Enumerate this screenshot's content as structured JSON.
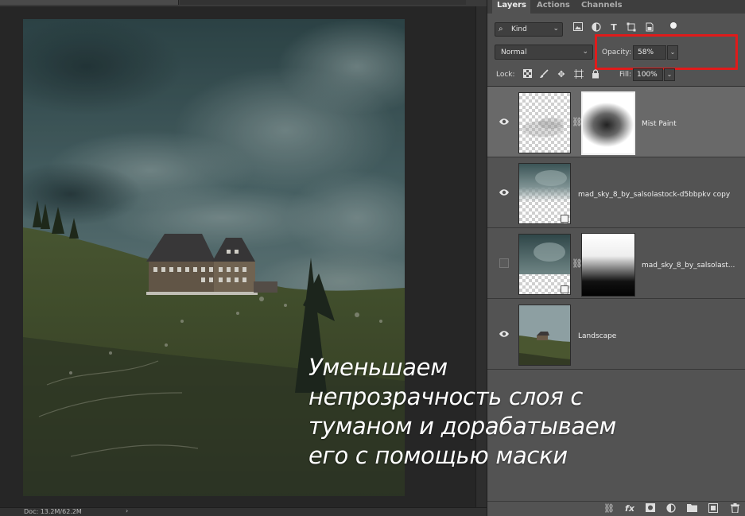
{
  "status": {
    "doc": "Doc: 13.2M/62.2M",
    "arrow": "›"
  },
  "caption": {
    "lines": [
      "Уменьшаем",
      "непрозрачность слоя с",
      "туманом и дорабатываем",
      "его с помощью маски"
    ]
  },
  "panel": {
    "tabs": [
      "Layers",
      "Actions",
      "Channels"
    ],
    "kind_label": "Kind",
    "blend_mode": "Normal",
    "opacity_label": "Opacity:",
    "opacity_value": "58%",
    "lock_label": "Lock:",
    "fill_label": "Fill:",
    "fill_value": "100%",
    "highlight_color": "#e01b1b"
  },
  "layers": [
    {
      "name": "Mist Paint",
      "visible": true,
      "selected": true
    },
    {
      "name": "mad_sky_8_by_salsolastock-d5bbpkv copy",
      "visible": true,
      "selected": false
    },
    {
      "name": "mad_sky_8_by_salsolast...",
      "visible": false,
      "selected": false
    },
    {
      "name": "Landscape",
      "visible": true,
      "selected": false
    }
  ],
  "icons": {
    "search": "search-icon",
    "filters": [
      "image-filter-icon",
      "adjustment-filter-icon",
      "type-filter-icon",
      "shape-filter-icon",
      "smart-object-filter-icon"
    ],
    "locks": [
      "lock-transparent-pixels-icon",
      "lock-image-pixels-icon",
      "lock-position-icon",
      "lock-artboard-icon",
      "lock-all-icon"
    ],
    "bottom": [
      "link-layers-icon",
      "layer-style-icon",
      "add-mask-icon",
      "adjustment-layer-icon",
      "group-icon",
      "new-layer-icon",
      "delete-layer-icon"
    ]
  }
}
